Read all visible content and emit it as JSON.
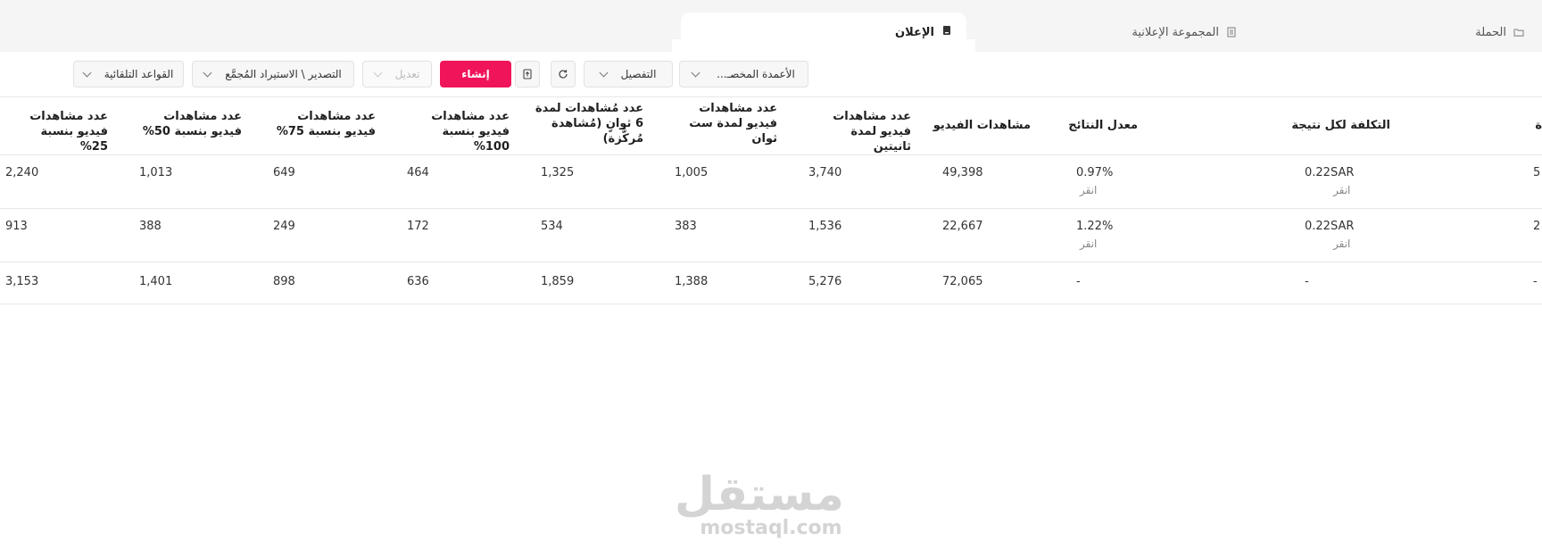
{
  "tabs": {
    "campaign": "الحملة",
    "adset": "المجموعة الإعلانية",
    "ad": "الإعلان"
  },
  "toolbar": {
    "columns": "الأعمدة المخصـ...",
    "breakdown": "التفصيل",
    "create": "إنشاء",
    "edit": "تعديل",
    "export": "التصدير \\ الاستيراد المُجمَّع",
    "rules": "القواعد التلقائية"
  },
  "headers": {
    "cost_per_result": "التكلفة لكل نتيجة",
    "result_rate": "معدل النتائج",
    "video_views": "مشاهدات الفيديو",
    "views_2s": "عدد مشاهدات فيديو لمدة ثانيتين",
    "views_6s": "عدد مشاهدات فيديو لمدة ست ثوان",
    "focused_6s": "عدد مُشاهدات لمدة 6 ثوانٍ (مُشاهدة مُركَّزة)",
    "p100": "عدد مشاهدات فيديو بنسبة 100%",
    "p75": "عدد مشاهدات فيديو بنسبة 75%",
    "p50": "عدد مشاهدات فيديو بنسبة 50%",
    "p25": "عدد مشاهدات فيديو بنسبة 25%"
  },
  "rows": [
    {
      "cost": "0.22SAR",
      "cost_sub": "انقر",
      "rate": "0.97%",
      "rate_sub": "انقر",
      "video_views": "49,398",
      "v2s": "3,740",
      "v6s": "1,005",
      "focused": "1,325",
      "p100": "464",
      "p75": "649",
      "p50": "1,013",
      "p25": "2,240",
      "edge": "5"
    },
    {
      "cost": "0.22SAR",
      "cost_sub": "انقر",
      "rate": "1.22%",
      "rate_sub": "انقر",
      "video_views": "22,667",
      "v2s": "1,536",
      "v6s": "383",
      "focused": "534",
      "p100": "172",
      "p75": "249",
      "p50": "388",
      "p25": "913",
      "edge": "2"
    },
    {
      "cost": "-",
      "cost_sub": "",
      "rate": "-",
      "rate_sub": "",
      "video_views": "72,065",
      "v2s": "5,276",
      "v6s": "1,388",
      "focused": "1,859",
      "p100": "636",
      "p75": "898",
      "p50": "1,401",
      "p25": "3,153",
      "edge": "-"
    }
  ],
  "header_edge": "ة",
  "watermark": {
    "arabic": "مستقل",
    "latin": "mostaql.com"
  }
}
